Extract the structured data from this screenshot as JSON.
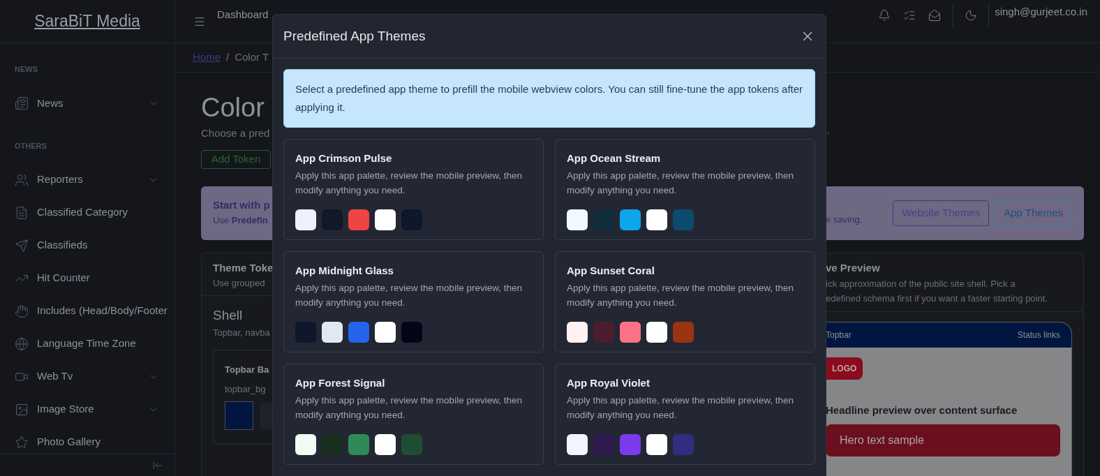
{
  "sidebar": {
    "brand": "SaraBiT Media",
    "sections": [
      {
        "heading": "NEWS",
        "items": [
          {
            "label": "News",
            "expandable": true
          }
        ]
      },
      {
        "heading": "OTHERS",
        "items": [
          {
            "label": "Reporters",
            "expandable": true
          },
          {
            "label": "Classified Category",
            "expandable": false
          },
          {
            "label": "Classifieds",
            "expandable": false
          },
          {
            "label": "Hit Counter",
            "expandable": false
          },
          {
            "label": "Includes (Head/Body/Footer",
            "expandable": false
          },
          {
            "label": "Language Time Zone",
            "expandable": false
          },
          {
            "label": "Web Tv",
            "expandable": true
          },
          {
            "label": "Image Store",
            "expandable": true
          },
          {
            "label": "Photo Gallery",
            "expandable": false
          }
        ]
      }
    ]
  },
  "topbar": {
    "nav": [
      "Dashboard"
    ],
    "user": "singh@gurjeet.co.in"
  },
  "breadcrumb": {
    "home": "Home",
    "separator": "/",
    "current": "Color T"
  },
  "page_left": {
    "title": "Color",
    "subtitle": "Choose a pred",
    "add_button": "Add Token",
    "alert_title": "Start with p",
    "alert_text": "Use **Predefin**",
    "card_title": "Theme Toke",
    "card_subtitle": "Use grouped",
    "section_title": "Shell",
    "section_subtitle": "Topbar, navba",
    "token_title": "Topbar Ba",
    "token_key": "topbar_bg"
  },
  "page_right": {
    "subtitle_end": ".",
    "alert_text": "e saving.",
    "buttons": [
      {
        "label": "Website Themes",
        "kind": "website"
      },
      {
        "label": "App Themes",
        "kind": "app"
      }
    ],
    "preview_title": "ve Preview",
    "preview_lines": [
      "ick approximation of the public site shell. Pick a",
      "edefined schema first if you want a faster starting point."
    ],
    "phone": {
      "topbar": "Topbar",
      "status": "Status links",
      "logo": "LOGO",
      "headline": "Headline preview over content surface",
      "hero": "Hero text sample"
    }
  },
  "modal": {
    "title": "Predefined App Themes",
    "info": "Select a predefined app theme to prefill the mobile webview colors. You can still fine-tune the app tokens after applying it.",
    "themes": [
      {
        "name": "App Crimson Pulse",
        "description": "Apply this app palette, review the mobile preview, then modify anything you need.",
        "swatches": [
          {
            "color": "#eef2ff"
          },
          {
            "color": "#111827"
          },
          {
            "color": "#ef4444"
          },
          {
            "color": "#ffffff"
          },
          {
            "color": "#0f172a"
          }
        ]
      },
      {
        "name": "App Ocean Stream",
        "description": "Apply this app palette, review the mobile preview, then modify anything you need.",
        "swatches": [
          {
            "color": "#f0f9ff"
          },
          {
            "color": "#0f2d3a"
          },
          {
            "color": "#0ea5e9"
          },
          {
            "color": "#ffffff"
          },
          {
            "color": "#0c4a6e"
          }
        ]
      },
      {
        "name": "App Midnight Glass",
        "description": "Apply this app palette, review the mobile preview, then modify anything you need.",
        "swatches": [
          {
            "color": "#0f172a"
          },
          {
            "color": "#e2e8f0"
          },
          {
            "color": "#2563eb"
          },
          {
            "color": "#ffffff"
          },
          {
            "color": "#020617"
          }
        ]
      },
      {
        "name": "App Sunset Coral",
        "description": "Apply this app palette, review the mobile preview, then modify anything you need.",
        "swatches": [
          {
            "color": "#fff1f2"
          },
          {
            "color": "#4c1d2f"
          },
          {
            "color": "#fb7185"
          },
          {
            "color": "#ffffff"
          },
          {
            "color": "#9a3412"
          }
        ]
      },
      {
        "name": "App Forest Signal",
        "description": "Apply this app palette, review the mobile preview, then modify anything you need.",
        "swatches": [
          {
            "color": "#f0fdf4"
          },
          {
            "color": "#1a2e1f"
          },
          {
            "color": "#2e8b57"
          },
          {
            "color": "#ffffff"
          },
          {
            "color": "#1d4d33"
          }
        ]
      },
      {
        "name": "App Royal Violet",
        "description": "Apply this app palette, review the mobile preview, then modify anything you need.",
        "swatches": [
          {
            "color": "#f5f3ff"
          },
          {
            "color": "#2e1a4f"
          },
          {
            "color": "#7c3aed"
          },
          {
            "color": "#ffffff"
          },
          {
            "color": "#312e81"
          }
        ]
      }
    ]
  }
}
